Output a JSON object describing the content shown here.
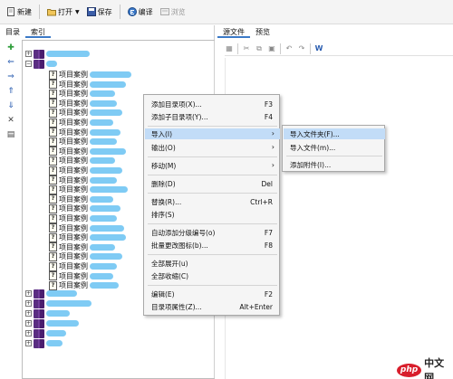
{
  "toolbar": {
    "new_label": "新建",
    "open_label": "打开",
    "save_label": "保存",
    "edit_label": "编译",
    "browse_label": "浏览"
  },
  "left": {
    "tabs": [
      "目录",
      "索引"
    ],
    "tree_items": [
      "项目案例",
      "项目案例",
      "项目案例",
      "项目案例",
      "项目案例",
      "项目案例",
      "项目案例",
      "项目案例",
      "项目案例",
      "项目案例",
      "项目案例",
      "项目案例",
      "项目案例",
      "项目案例",
      "项目案例",
      "项目案例",
      "项目案例",
      "项目案例",
      "项目案例",
      "项目案例",
      "项目案例",
      "项目案例",
      "项目案例"
    ]
  },
  "right": {
    "tabs": [
      "源文件",
      "预览"
    ]
  },
  "context_menu": {
    "add_sibling": "添加目录项(X)...",
    "add_sibling_sc": "F3",
    "add_child": "添加子目录项(Y)...",
    "add_child_sc": "F4",
    "import": "导入(I)",
    "export": "输出(O)",
    "move": "移动(M)",
    "delete": "删除(D)",
    "delete_sc": "Del",
    "replace": "替换(R)...",
    "replace_sc": "Ctrl+R",
    "sort": "排序(S)",
    "auto_number": "自动添加分级编号(o)",
    "auto_number_sc": "F7",
    "batch_icon": "批量更改图标(b)...",
    "batch_icon_sc": "F8",
    "expand_all": "全部展开(u)",
    "collapse_all": "全部收缩(C)",
    "edit": "编辑(E)",
    "edit_sc": "F2",
    "properties": "目录项属性(Z)...",
    "properties_sc": "Alt+Enter"
  },
  "submenu": {
    "import_folder": "导入文件夹(F)...",
    "import_file": "导入文件(m)...",
    "add_attachment": "添加附件(I)..."
  },
  "watermark": {
    "php": "php",
    "site": "中文网"
  },
  "colors": {
    "highlight": "#c2dcf7",
    "blur": "#69c2f2",
    "book": "#5a2d82",
    "watermark_red": "#d81e2c"
  }
}
